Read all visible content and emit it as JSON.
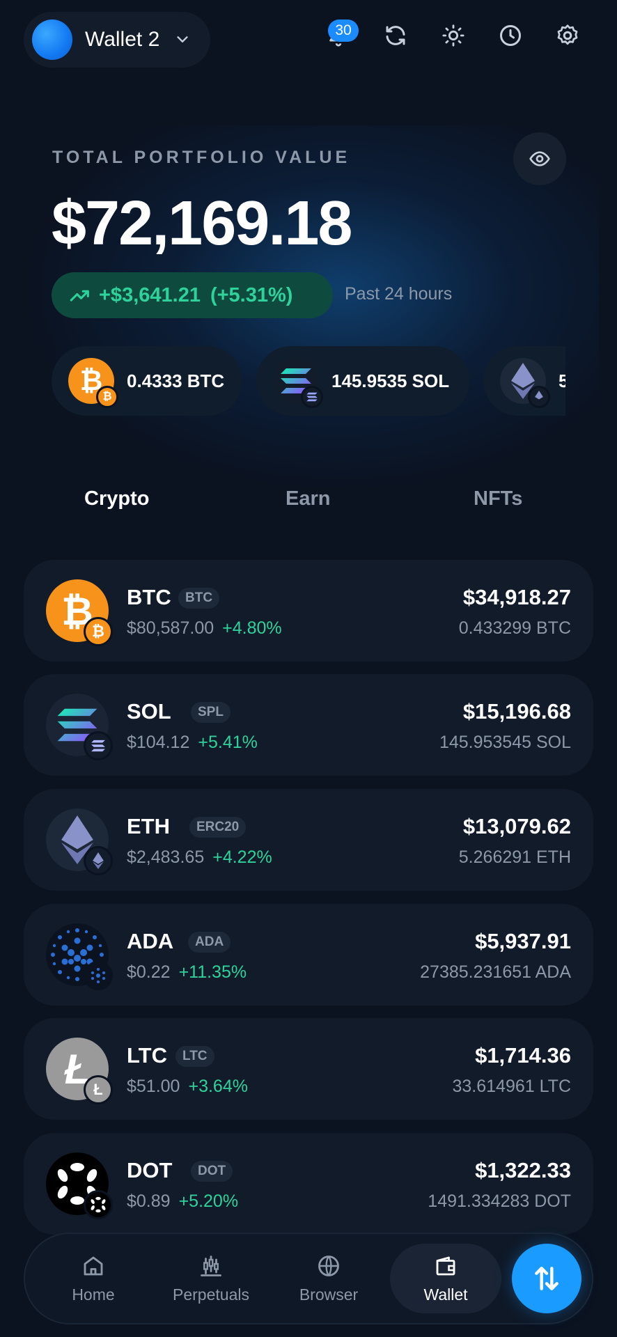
{
  "header": {
    "wallet_name": "Wallet 2",
    "notification_count": "30",
    "icons": [
      "bell-icon",
      "refresh-icon",
      "sun-icon",
      "history-icon",
      "gear-icon"
    ]
  },
  "portfolio": {
    "label": "TOTAL PORTFOLIO VALUE",
    "value": "$72,169.18",
    "change_amount": "+$3,641.21",
    "change_percent": "(+5.31%)",
    "change_period": "Past 24 hours",
    "change_color": "#2dd39a"
  },
  "chips": [
    {
      "label": "0.4333 BTC",
      "icon": "btc-icon"
    },
    {
      "label": "145.9535 SOL",
      "icon": "sol-icon"
    },
    {
      "label": "5",
      "icon": "eth-icon"
    }
  ],
  "tabs": [
    {
      "label": "Crypto",
      "active": true
    },
    {
      "label": "Earn",
      "active": false
    },
    {
      "label": "NFTs",
      "active": false
    }
  ],
  "assets": [
    {
      "symbol": "BTC",
      "tag": "BTC",
      "price": "$80,587.00",
      "change": "+4.80%",
      "usd_value": "$34,918.27",
      "amount": "0.433299 BTC",
      "icon": "btc-icon"
    },
    {
      "symbol": "SOL",
      "tag": "SPL",
      "price": "$104.12",
      "change": "+5.41%",
      "usd_value": "$15,196.68",
      "amount": "145.953545 SOL",
      "icon": "sol-icon"
    },
    {
      "symbol": "ETH",
      "tag": "ERC20",
      "price": "$2,483.65",
      "change": "+4.22%",
      "usd_value": "$13,079.62",
      "amount": "5.266291 ETH",
      "icon": "eth-icon"
    },
    {
      "symbol": "ADA",
      "tag": "ADA",
      "price": "$0.22",
      "change": "+11.35%",
      "usd_value": "$5,937.91",
      "amount": "27385.231651 ADA",
      "icon": "ada-icon"
    },
    {
      "symbol": "LTC",
      "tag": "LTC",
      "price": "$51.00",
      "change": "+3.64%",
      "usd_value": "$1,714.36",
      "amount": "33.614961 LTC",
      "icon": "ltc-icon"
    },
    {
      "symbol": "DOT",
      "tag": "DOT",
      "price": "$0.89",
      "change": "+5.20%",
      "usd_value": "$1,322.33",
      "amount": "1491.334283 DOT",
      "icon": "dot-icon"
    }
  ],
  "nav": [
    {
      "label": "Home",
      "icon": "home-icon",
      "active": false
    },
    {
      "label": "Perpetuals",
      "icon": "candlestick-icon",
      "active": false
    },
    {
      "label": "Browser",
      "icon": "globe-icon",
      "active": false
    },
    {
      "label": "Wallet",
      "icon": "wallet-icon",
      "active": true
    }
  ],
  "colors": {
    "background": "#0b1220",
    "accent": "#1a9bff",
    "positive": "#2dd39a",
    "muted": "#8d98a8"
  }
}
